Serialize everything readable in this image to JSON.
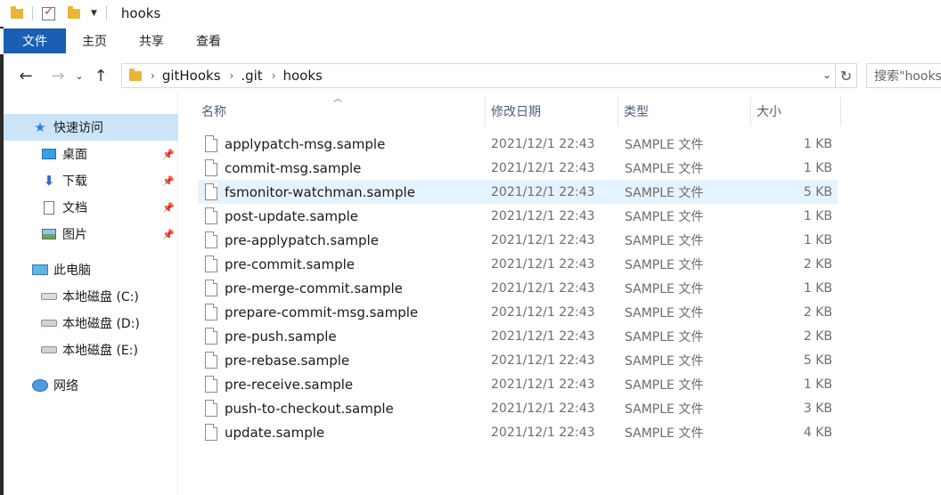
{
  "window": {
    "title": "hooks"
  },
  "ribbon": {
    "tabs": [
      "文件",
      "主页",
      "共享",
      "查看"
    ]
  },
  "nav": {
    "breadcrumbs": [
      "gitHooks",
      ".git",
      "hooks"
    ],
    "search_placeholder": "搜索\"hooks\""
  },
  "sidebar": {
    "quick_access": "快速访问",
    "pinned": [
      "桌面",
      "下载",
      "文档",
      "图片"
    ],
    "this_pc": "此电脑",
    "drives": [
      "本地磁盘 (C:)",
      "本地磁盘 (D:)",
      "本地磁盘 (E:)"
    ],
    "network": "网络"
  },
  "columns": {
    "name": "名称",
    "date": "修改日期",
    "type": "类型",
    "size": "大小"
  },
  "files": [
    {
      "name": "applypatch-msg.sample",
      "date": "2021/12/1 22:43",
      "type": "SAMPLE 文件",
      "size": "1 KB"
    },
    {
      "name": "commit-msg.sample",
      "date": "2021/12/1 22:43",
      "type": "SAMPLE 文件",
      "size": "1 KB"
    },
    {
      "name": "fsmonitor-watchman.sample",
      "date": "2021/12/1 22:43",
      "type": "SAMPLE 文件",
      "size": "5 KB"
    },
    {
      "name": "post-update.sample",
      "date": "2021/12/1 22:43",
      "type": "SAMPLE 文件",
      "size": "1 KB"
    },
    {
      "name": "pre-applypatch.sample",
      "date": "2021/12/1 22:43",
      "type": "SAMPLE 文件",
      "size": "1 KB"
    },
    {
      "name": "pre-commit.sample",
      "date": "2021/12/1 22:43",
      "type": "SAMPLE 文件",
      "size": "2 KB"
    },
    {
      "name": "pre-merge-commit.sample",
      "date": "2021/12/1 22:43",
      "type": "SAMPLE 文件",
      "size": "1 KB"
    },
    {
      "name": "prepare-commit-msg.sample",
      "date": "2021/12/1 22:43",
      "type": "SAMPLE 文件",
      "size": "2 KB"
    },
    {
      "name": "pre-push.sample",
      "date": "2021/12/1 22:43",
      "type": "SAMPLE 文件",
      "size": "2 KB"
    },
    {
      "name": "pre-rebase.sample",
      "date": "2021/12/1 22:43",
      "type": "SAMPLE 文件",
      "size": "5 KB"
    },
    {
      "name": "pre-receive.sample",
      "date": "2021/12/1 22:43",
      "type": "SAMPLE 文件",
      "size": "1 KB"
    },
    {
      "name": "push-to-checkout.sample",
      "date": "2021/12/1 22:43",
      "type": "SAMPLE 文件",
      "size": "3 KB"
    },
    {
      "name": "update.sample",
      "date": "2021/12/1 22:43",
      "type": "SAMPLE 文件",
      "size": "4 KB"
    }
  ],
  "colors": {
    "file_tab": "#1a5fb4",
    "selected": "#cce4f7",
    "hover_row": "#e5f3ff"
  }
}
